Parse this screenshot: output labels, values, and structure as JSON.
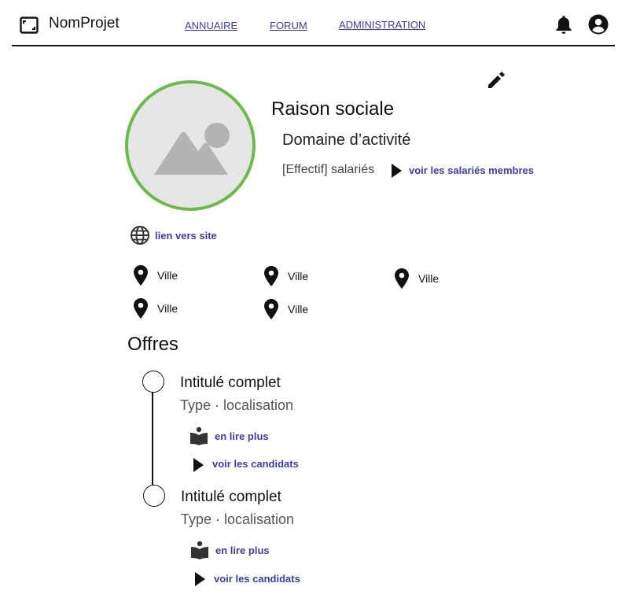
{
  "header": {
    "app_name": "NomProjet",
    "nav": [
      "ANNUAIRE",
      "FORUM",
      "ADMINISTRATION"
    ],
    "icons": [
      "fullscreen-icon",
      "bell-icon",
      "account-icon"
    ]
  },
  "profile": {
    "company_name": "Raison sociale",
    "domain": "Domaine d’activité",
    "effectif": "[Effectif] salariés",
    "see_members": "voir les salariés membres",
    "website_link": "lien vers site",
    "avatar_ring_color": "#6abb48",
    "locations": [
      "Ville",
      "Ville",
      "Ville",
      "Ville",
      "Ville"
    ]
  },
  "offers": {
    "title": "Offres",
    "items": [
      {
        "title": "Intitulé complet",
        "subtitle": "Type · localisation",
        "read_more": "en lire plus",
        "see_candidates": "voir les candidats"
      },
      {
        "title": "Intitulé complet",
        "subtitle": "Type · localisation",
        "read_more": "en lire plus",
        "see_candidates": "voir les candidats"
      }
    ]
  },
  "colors": {
    "link": "#3b3fa3",
    "accent": "#6abb48"
  }
}
